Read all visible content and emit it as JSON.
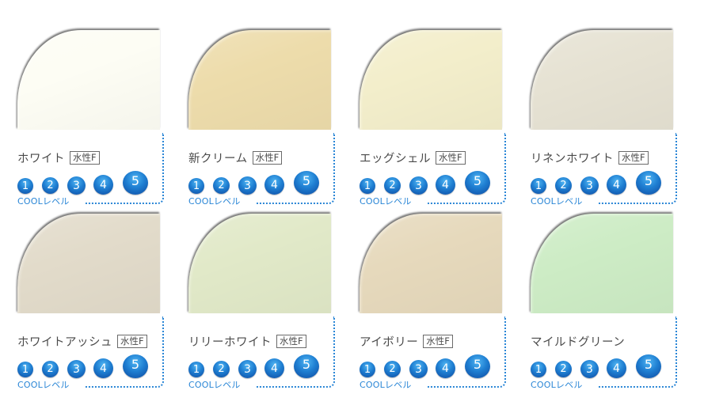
{
  "swatches": [
    {
      "name": "ホワイト",
      "badge": "水性F",
      "color": "#fdfdf4"
    },
    {
      "name": "新クリーム",
      "badge": "水性F",
      "color": "#eddcab"
    },
    {
      "name": "エッグシェル",
      "badge": "水性F",
      "color": "#f3eecb"
    },
    {
      "name": "リネンホワイト",
      "badge": "水性F",
      "color": "#e6e2d3"
    },
    {
      "name": "ホワイトアッシュ",
      "badge": "水性F",
      "color": "#e2dbca"
    },
    {
      "name": "リリーホワイト",
      "badge": "水性F",
      "color": "#e1e9c8"
    },
    {
      "name": "アイボリー",
      "badge": "水性F",
      "color": "#e6d9bc"
    },
    {
      "name": "マイルドグリーン",
      "badge": "",
      "color": "#cdecc5"
    }
  ],
  "levels": [
    "1",
    "2",
    "3",
    "4",
    "5"
  ],
  "cool_label": "COOLレベル",
  "accent_color": "#2a86d6"
}
